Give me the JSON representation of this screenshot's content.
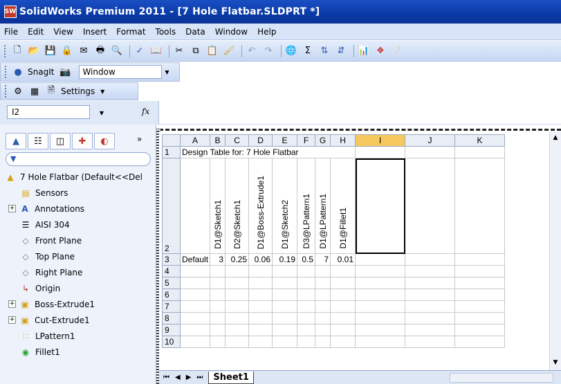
{
  "window": {
    "title": "SolidWorks Premium 2011 - [7 Hole Flatbar.SLDPRT *]",
    "app_icon": "SW"
  },
  "menu": [
    "File",
    "Edit",
    "View",
    "Insert",
    "Format",
    "Tools",
    "Data",
    "Window",
    "Help"
  ],
  "toolbar2": {
    "snagit_label": "SnagIt",
    "window_select": "Window"
  },
  "toolbar3": {
    "settings_label": "Settings"
  },
  "formula": {
    "namebox": "I2",
    "fx": "fx"
  },
  "tree": {
    "root": "7 Hole Flatbar  (Default<<Del",
    "items": [
      {
        "label": "Sensors",
        "expand": false
      },
      {
        "label": "Annotations",
        "expand": true
      },
      {
        "label": "AISI 304",
        "expand": false
      },
      {
        "label": "Front Plane",
        "expand": false
      },
      {
        "label": "Top Plane",
        "expand": false
      },
      {
        "label": "Right Plane",
        "expand": false
      },
      {
        "label": "Origin",
        "expand": false
      },
      {
        "label": "Boss-Extrude1",
        "expand": true
      },
      {
        "label": "Cut-Extrude1",
        "expand": true
      },
      {
        "label": "LPattern1",
        "expand": false
      },
      {
        "label": "Fillet1",
        "expand": false
      }
    ]
  },
  "sheet": {
    "columns": [
      "A",
      "B",
      "C",
      "D",
      "E",
      "F",
      "G",
      "H",
      "I",
      "J",
      "K"
    ],
    "rows": [
      "1",
      "2",
      "3",
      "4",
      "5",
      "6",
      "7",
      "8",
      "9",
      "10"
    ],
    "title": "Design Table for: 7 Hole Flatbar",
    "params": [
      "D1@Sketch1",
      "D2@Sketch1",
      "D1@Boss-Extrude1",
      "D1@Sketch2",
      "D3@LPattern1",
      "D1@LPattern1",
      "D1@Fillet1"
    ],
    "config": "Default",
    "values": [
      "3",
      "0.25",
      "0.06",
      "0.19",
      "0.5",
      "7",
      "0.01"
    ],
    "tab": "Sheet1"
  },
  "colors": {
    "title_bar": "#0a3aa8",
    "selected_col": "#f5c95e"
  }
}
